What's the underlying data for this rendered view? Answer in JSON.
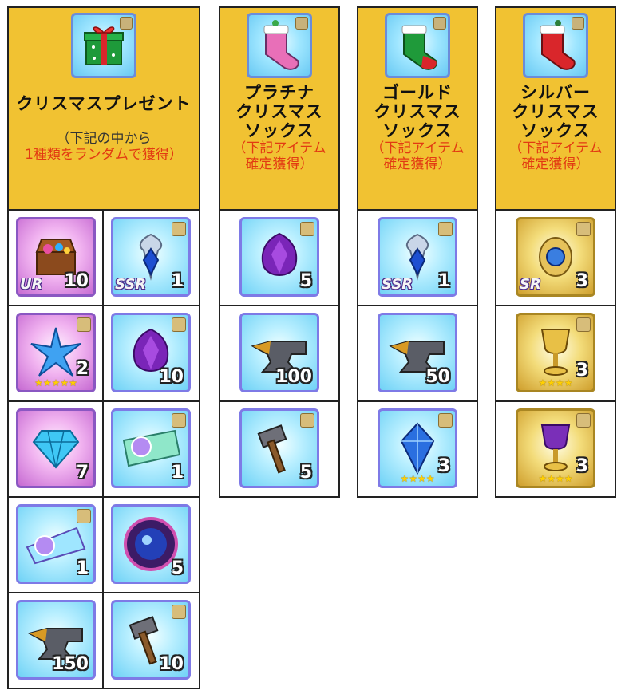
{
  "columns": [
    {
      "title": "クリスマスプレゼント",
      "icon": "gift-box-icon",
      "note_lines": [
        {
          "text": "（下記の中から",
          "color": "black"
        },
        {
          "text": "1種類をランダムで獲得）",
          "color": "red"
        }
      ],
      "items": [
        {
          "icon": "treasure-chest-icon",
          "qty": "10",
          "rank": "UR",
          "stars": "",
          "bg": "pink"
        },
        {
          "icon": "sapphire-amulet-icon",
          "qty": "1",
          "rank": "SSR",
          "stars": "",
          "bg": "blue"
        },
        {
          "icon": "blue-crystal-star-icon",
          "qty": "2",
          "rank": "",
          "stars": "★★★★★",
          "bg": "pink"
        },
        {
          "icon": "purple-gem-icon",
          "qty": "10",
          "rank": "",
          "stars": "",
          "bg": "blue"
        },
        {
          "icon": "blue-diamond-icon",
          "qty": "7",
          "rank": "",
          "stars": "",
          "bg": "pink"
        },
        {
          "icon": "ssr-ticket-part1-icon",
          "qty": "1",
          "rank": "",
          "stars": "",
          "bg": "blue"
        },
        {
          "icon": "ssr-ticket-part2-icon",
          "qty": "1",
          "rank": "",
          "stars": "",
          "bg": "blue"
        },
        {
          "icon": "cosmic-orb-icon",
          "qty": "5",
          "rank": "",
          "stars": "",
          "bg": "blue"
        },
        {
          "icon": "anvil-icon",
          "qty": "150",
          "rank": "",
          "stars": "",
          "bg": "blue"
        },
        {
          "icon": "hammer-icon",
          "qty": "10",
          "rank": "",
          "stars": "",
          "bg": "blue"
        }
      ]
    },
    {
      "title_lines": [
        "プラチナ",
        "クリスマス",
        "ソックス"
      ],
      "icon": "platinum-stocking-icon",
      "note_lines": [
        {
          "text": "（下記アイテム",
          "color": "red"
        },
        {
          "text": "確定獲得）",
          "color": "red"
        }
      ],
      "items": [
        {
          "icon": "purple-gem-icon",
          "qty": "5",
          "rank": "",
          "stars": "",
          "bg": "blue"
        },
        {
          "icon": "anvil-icon",
          "qty": "100",
          "rank": "",
          "stars": "",
          "bg": "blue"
        },
        {
          "icon": "hammer-icon",
          "qty": "5",
          "rank": "",
          "stars": "",
          "bg": "blue"
        }
      ]
    },
    {
      "title_lines": [
        "ゴールド",
        "クリスマス",
        "ソックス"
      ],
      "icon": "gold-stocking-icon",
      "note_lines": [
        {
          "text": "（下記アイテム",
          "color": "red"
        },
        {
          "text": "確定獲得）",
          "color": "red"
        }
      ],
      "items": [
        {
          "icon": "sapphire-amulet-icon",
          "qty": "1",
          "rank": "SSR",
          "stars": "",
          "bg": "blue"
        },
        {
          "icon": "anvil-icon",
          "qty": "50",
          "rank": "",
          "stars": "",
          "bg": "blue"
        },
        {
          "icon": "blue-crystal-icon",
          "qty": "3",
          "rank": "",
          "stars": "★★★★",
          "bg": "blue"
        }
      ]
    },
    {
      "title_lines": [
        "シルバー",
        "クリスマス",
        "ソックス"
      ],
      "icon": "silver-stocking-icon",
      "note_lines": [
        {
          "text": "（下記アイテム",
          "color": "red"
        },
        {
          "text": "確定獲得）",
          "color": "red"
        }
      ],
      "items": [
        {
          "icon": "gold-pendant-icon",
          "qty": "3",
          "rank": "SR",
          "stars": "",
          "bg": "gold"
        },
        {
          "icon": "gold-chalice-icon",
          "qty": "3",
          "rank": "",
          "stars": "★★★★",
          "bg": "gold"
        },
        {
          "icon": "purple-chalice-icon",
          "qty": "3",
          "rank": "",
          "stars": "★★★★",
          "bg": "gold"
        }
      ]
    }
  ]
}
